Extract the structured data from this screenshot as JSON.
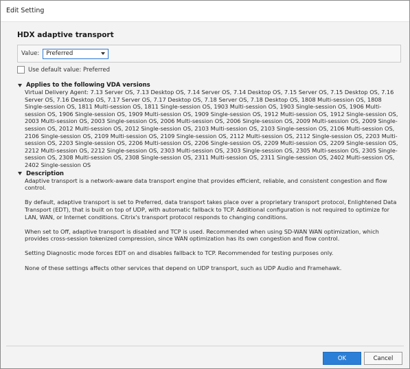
{
  "window": {
    "title": "Edit Setting"
  },
  "setting": {
    "title": "HDX adaptive transport",
    "value_label": "Value:",
    "value_selected": "Preferred",
    "use_default_label": "Use default value: Preferred"
  },
  "applies": {
    "heading": "Applies to the following VDA versions",
    "text": "Virtual Delivery Agent: 7.13 Server OS, 7.13 Desktop OS, 7.14 Server OS, 7.14 Desktop OS, 7.15 Server OS, 7.15 Desktop OS, 7.16 Server OS, 7.16 Desktop OS, 7.17 Server OS, 7.17 Desktop OS, 7.18 Server OS, 7.18 Desktop OS, 1808 Multi-session OS, 1808 Single-session OS, 1811 Multi-session OS, 1811 Single-session OS, 1903 Multi-session OS, 1903 Single-session OS, 1906 Multi-session OS, 1906 Single-session OS, 1909 Multi-session OS, 1909 Single-session OS, 1912 Multi-session OS, 1912 Single-session OS, 2003 Multi-session OS, 2003 Single-session OS, 2006 Multi-session OS, 2006 Single-session OS, 2009 Multi-session OS, 2009 Single-session OS, 2012 Multi-session OS, 2012 Single-session OS, 2103 Multi-session OS, 2103 Single-session OS, 2106 Multi-session OS, 2106 Single-session OS, 2109 Multi-session OS, 2109 Single-session OS, 2112 Multi-session OS, 2112 Single-session OS, 2203 Multi-session OS, 2203 Single-session OS, 2206 Multi-session OS, 2206 Single-session OS, 2209 Multi-session OS, 2209 Single-session OS, 2212 Multi-session OS, 2212 Single-session OS, 2303 Multi-session OS, 2303 Single-session OS, 2305 Multi-session OS, 2305 Single-session OS, 2308 Multi-session OS, 2308 Single-session OS, 2311 Multi-session OS, 2311 Single-session OS, 2402 Multi-session OS, 2402 Single-session OS"
  },
  "description": {
    "heading": "Description",
    "paragraphs": [
      "Adaptive transport is a network-aware data transport engine that provides efficient, reliable, and consistent congestion and flow control.",
      "By default, adaptive transport is set to Preferred, data transport takes place over a proprietary transport protocol, Enlightened Data Transport (EDT), that is built on top of UDP, with automatic fallback to TCP. Additional configuration is not required to optimize for LAN, WAN, or Internet conditions. Citrix's transport protocol responds to changing conditions.",
      "When set to Off, adaptive transport is disabled and TCP is used. Recommended when using SD-WAN WAN optimization, which provides cross-session tokenized compression, since WAN optimization has its own congestion and flow control.",
      "Setting Diagnostic mode forces EDT on and disables fallback to TCP. Recommended for testing purposes only.",
      "None of these settings affects other services that depend on UDP transport, such as UDP Audio and Framehawk."
    ]
  },
  "buttons": {
    "ok": "OK",
    "cancel": "Cancel"
  },
  "colors": {
    "accent": "#2b7fd6",
    "background": "#f3f3f3"
  }
}
